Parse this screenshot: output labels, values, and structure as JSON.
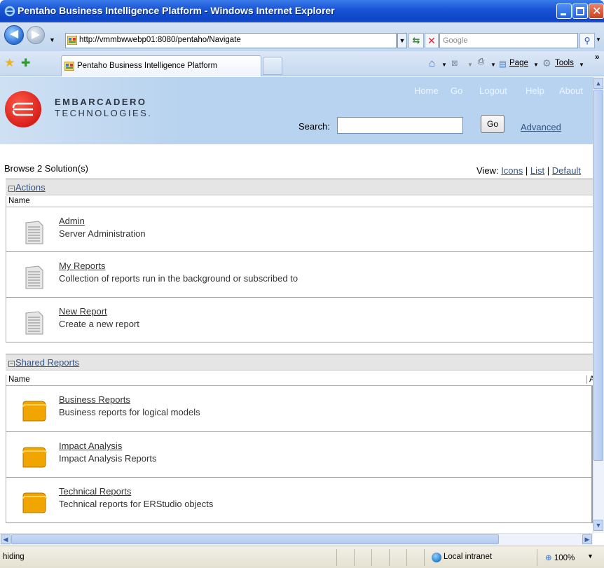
{
  "window": {
    "title": "Pentaho Business Intelligence Platform - Windows Internet Explorer"
  },
  "addressbar": {
    "url": "http://vmmbwwebp01:8080/pentaho/Navigate",
    "search_placeholder": "Google"
  },
  "tabs": {
    "active_title": "Pentaho Business Intelligence Platform"
  },
  "commandbar": {
    "page_label": "Page",
    "tools_label": "Tools"
  },
  "header": {
    "logo_name": "EMBARCADERO",
    "logo_tech": "TECHNOLOGIES.",
    "nav": [
      "Home",
      "Go",
      "Logout",
      "Help",
      "About"
    ],
    "search_label": "Search:",
    "search_value": "",
    "go_label": "Go",
    "advanced_label": "Advanced"
  },
  "view": {
    "label": "View:",
    "options": [
      "Icons",
      "List",
      "Default"
    ],
    "separator": "|"
  },
  "browse_title": "Browse 2 Solution(s)",
  "sections": [
    {
      "title": "Actions",
      "column": "Name",
      "items": [
        {
          "name": "Admin",
          "description": "Server Administration"
        },
        {
          "name": "My Reports",
          "description": "Collection of reports run in the background or subscribed to"
        },
        {
          "name": "New Report",
          "description": "Create a new report"
        }
      ]
    },
    {
      "title": "Shared Reports",
      "column": "Name",
      "column2": "A",
      "items": [
        {
          "name": "Business Reports",
          "description": "Business reports for logical models"
        },
        {
          "name": "Impact Analysis",
          "description": "Impact Analysis Reports"
        },
        {
          "name": "Technical Reports",
          "description": "Technical reports for ERStudio objects"
        }
      ]
    }
  ],
  "statusbar": {
    "text": "hiding",
    "zone": "Local intranet",
    "zoom": "100%"
  },
  "colors": {
    "banner": "#b8d3ef",
    "link": "#335588",
    "logo_red": "#d8201a",
    "folder": "#f0a500"
  }
}
